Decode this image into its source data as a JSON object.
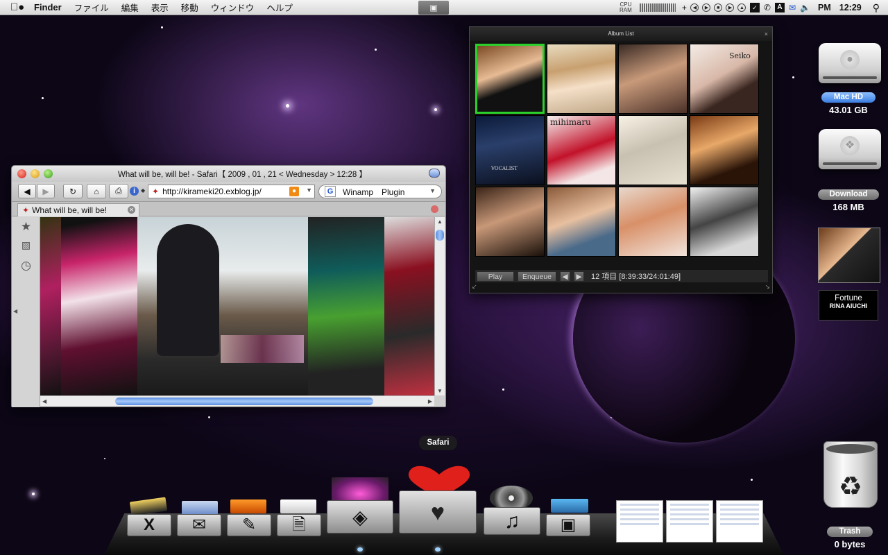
{
  "menubar": {
    "app": "Finder",
    "items": [
      "ファイル",
      "編集",
      "表示",
      "移動",
      "ウィンドウ",
      "ヘルプ"
    ],
    "cpu_label": "CPU",
    "ram_label": "RAM",
    "period": "PM",
    "time": "12:29"
  },
  "safari": {
    "title": "What will be, will be! - Safari【 2009 , 01 , 21 < Wednesday > 12:28 】",
    "url": "http://kirameki20.exblog.jp/",
    "search_text": "Winamp　Plugin",
    "tab_label": "What will be, will be!"
  },
  "album_list": {
    "title": "Album List",
    "cell_texts": [
      "Seiko",
      "VOCALIST",
      "mihimaru"
    ],
    "play_label": "Play",
    "enqueue_label": "Enqueue",
    "status": "12 項目 [8:39:33/24:01:49]"
  },
  "desktop": {
    "mac_hd_label": "Mac HD",
    "mac_hd_size": "43.01 GB",
    "download_label": "Download",
    "download_size": "168 MB",
    "now_playing_title": "Fortune",
    "now_playing_artist": "RINA AIUCHI",
    "trash_label": "Trash",
    "trash_size": "0 bytes"
  },
  "dock": {
    "tooltip": "Safari"
  }
}
